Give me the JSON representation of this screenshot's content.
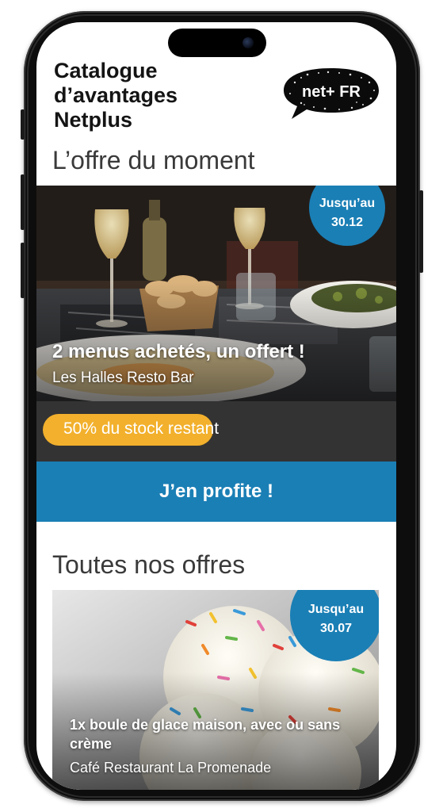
{
  "header": {
    "title": "Catalogue\nd’avantages\nNetplus",
    "logo_text": "net+ FR"
  },
  "featured": {
    "section_title": "L’offre du moment",
    "badge_line1": "Jusqu’au",
    "badge_line2": "30.12",
    "title": "2 menus achetés, un offert !",
    "subtitle": "Les Halles Resto Bar",
    "stock_label": "50% du stock restant",
    "stock_fraction": 0.5,
    "cta_label": "J’en profite !"
  },
  "all_offers": {
    "section_title": "Toutes nos offres",
    "items": [
      {
        "badge_line1": "Jusqu’au",
        "badge_line2": "30.07",
        "title": "1x boule de glace maison, avec ou sans crème",
        "subtitle": "Café Restaurant La Promenade"
      }
    ]
  },
  "colors": {
    "brand_blue": "#1a7fb5",
    "stock_yellow": "#f2b02c",
    "stock_bar_bg": "#333333"
  }
}
